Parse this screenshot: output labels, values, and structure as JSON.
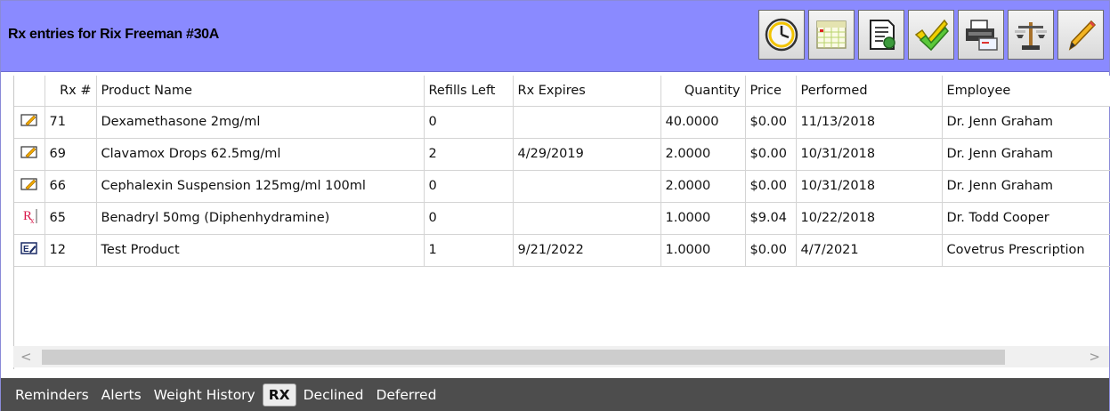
{
  "header": {
    "title": "Rx entries for Rix Freeman #30A"
  },
  "toolbar": [
    {
      "name": "clock-icon"
    },
    {
      "name": "calendar-icon"
    },
    {
      "name": "document-icon"
    },
    {
      "name": "checkmarks-icon"
    },
    {
      "name": "printer-icon"
    },
    {
      "name": "scale-icon"
    },
    {
      "name": "pencil-icon"
    }
  ],
  "columns": [
    "Rx #",
    "Product Name",
    "Refills Left",
    "Rx Expires",
    "Quantity",
    "Price",
    "Performed",
    "Employee"
  ],
  "rows": [
    {
      "icon": "edit-note-icon",
      "rx": "71",
      "product": "Dexamethasone 2mg/ml",
      "refills": "0",
      "expires": "",
      "quantity": "40.0000",
      "price": "$0.00",
      "performed": "11/13/2018",
      "employee": "Dr.  Jenn Graham"
    },
    {
      "icon": "edit-note-icon",
      "rx": "69",
      "product": "Clavamox Drops 62.5mg/ml",
      "refills": "2",
      "expires": "4/29/2019",
      "quantity": "2.0000",
      "price": "$0.00",
      "performed": "10/31/2018",
      "employee": "Dr.  Jenn Graham"
    },
    {
      "icon": "edit-note-icon",
      "rx": "66",
      "product": "Cephalexin Suspension 125mg/ml 100ml",
      "refills": "0",
      "expires": "",
      "quantity": "2.0000",
      "price": "$0.00",
      "performed": "10/31/2018",
      "employee": "Dr.  Jenn Graham"
    },
    {
      "icon": "rx-icon",
      "rx": "65",
      "product": "Benadryl 50mg (Diphenhydramine)",
      "refills": "0",
      "expires": "",
      "quantity": "1.0000",
      "price": "$9.04",
      "performed": "10/22/2018",
      "employee": "Dr.  Todd Cooper"
    },
    {
      "icon": "e-prescription-icon",
      "rx": "12",
      "product": "Test Product",
      "refills": "1",
      "expires": "9/21/2022",
      "quantity": "1.0000",
      "price": "$0.00",
      "performed": "4/7/2021",
      "employee": "Covetrus Prescription"
    }
  ],
  "scrollbar": {
    "left": "<",
    "right": ">"
  },
  "tabs": [
    "Reminders",
    "Alerts",
    "Weight History",
    "RX",
    "Declined",
    "Deferred"
  ],
  "active_tab": "RX"
}
